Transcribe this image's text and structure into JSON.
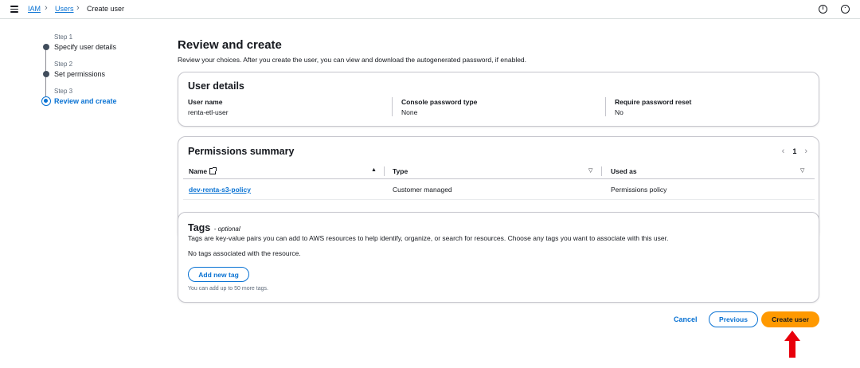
{
  "breadcrumb": {
    "root": "IAM",
    "parent": "Users",
    "current": "Create user"
  },
  "header_icons": [
    "info-icon",
    "settings-icon"
  ],
  "steps": [
    {
      "number": "Step 1",
      "label": "Specify user details",
      "state": "complete"
    },
    {
      "number": "Step 2",
      "label": "Set permissions",
      "state": "complete"
    },
    {
      "number": "Step 3",
      "label": "Review and create",
      "state": "active"
    }
  ],
  "page": {
    "title": "Review and create",
    "description": "Review your choices. After you create the user, you can view and download the autogenerated password, if enabled."
  },
  "user_details": {
    "title": "User details",
    "fields": [
      {
        "label": "User name",
        "value": "renta-etl-user"
      },
      {
        "label": "Console password type",
        "value": "None"
      },
      {
        "label": "Require password reset",
        "value": "No"
      }
    ]
  },
  "permissions": {
    "title": "Permissions summary",
    "page_number": "1",
    "columns": [
      "Name",
      "Type",
      "Used as"
    ],
    "rows": [
      {
        "name": "dev-renta-s3-policy",
        "type": "Customer managed",
        "used_as": "Permissions policy"
      }
    ]
  },
  "tags": {
    "title": "Tags",
    "optional": "- optional",
    "description": "Tags are key-value pairs you can add to AWS resources to help identify, organize, or search for resources. Choose any tags you want to associate with this user.",
    "empty_text": "No tags associated with the resource.",
    "add_button": "Add new tag",
    "hint": "You can add up to 50 more tags."
  },
  "footer": {
    "cancel": "Cancel",
    "previous": "Previous",
    "create": "Create user"
  },
  "colors": {
    "link": "#0972d3",
    "primary_button": "#ff9900",
    "annotation_arrow": "#e8000b"
  }
}
